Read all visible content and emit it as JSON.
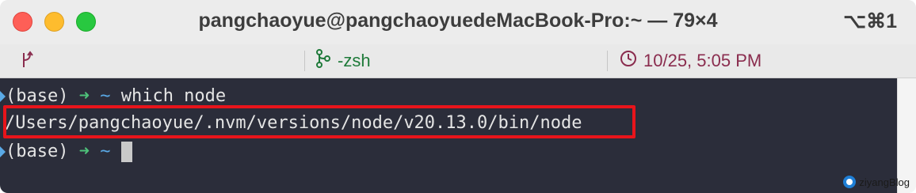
{
  "window": {
    "title": "pangchaoyue@pangchaoyuedeMacBook-Pro:~ — 79×4",
    "shortcut": "⌥⌘1"
  },
  "tabs": {
    "left_icon": "branch-icon",
    "zsh": {
      "icon": "git-branch-icon",
      "label": "-zsh"
    },
    "time": {
      "icon": "clock-icon",
      "label": "10/25, 5:05 PM"
    }
  },
  "terminal": {
    "line1": {
      "env": "(base) ",
      "arrow": "➜",
      "dir": "~",
      "command": " which node"
    },
    "line2": {
      "output": "/Users/pangchaoyue/.nvm/versions/node/v20.13.0/bin/node"
    },
    "line3": {
      "env": "(base) ",
      "arrow": "➜",
      "dir": "~"
    }
  },
  "colors": {
    "highlight_box": "#e8141b",
    "terminal_bg": "#2b2d3a",
    "prompt_arrow": "#4ec27a",
    "prompt_dir": "#5aa9e6"
  },
  "watermark": {
    "text": "ziyangBlog"
  }
}
